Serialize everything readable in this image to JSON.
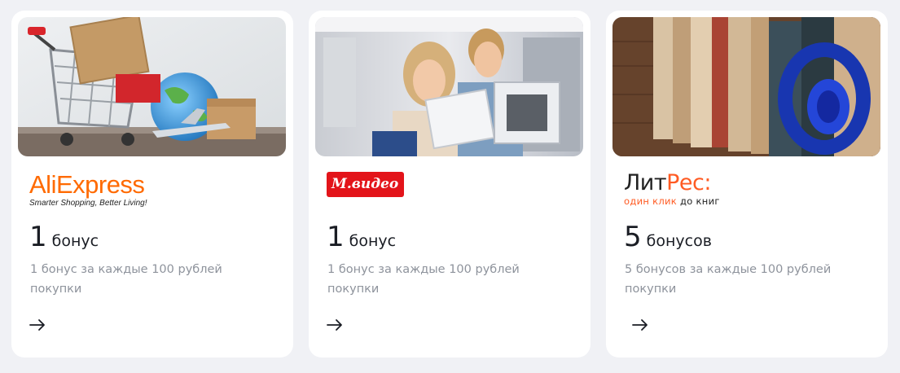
{
  "cards": [
    {
      "brand": "AliExpress",
      "brand_first": "Ali",
      "brand_rest": "Express",
      "tagline": "Smarter Shopping, Better Living!",
      "amount": "1",
      "unit": "бонус",
      "description": "1 бонус за каждые 100 рублей покупки",
      "photo_icon": "shopping-cart-with-boxes-photo",
      "accent_color": "#ff6a00"
    },
    {
      "brand": "М.видео",
      "amount": "1",
      "unit": "бонус",
      "description": "1 бонус за каждые 100 рублей покупки",
      "photo_icon": "couple-with-appliances-photo",
      "accent_color": "#e3141a"
    },
    {
      "brand": "ЛитРес",
      "brand_first": "Лит",
      "brand_rest": "Рес:",
      "tagline_accent": "один клик",
      "tagline_rest": " до книг",
      "amount": "5",
      "unit": "бонусов",
      "description": "5 бонусов за каждые 100 рублей покупки",
      "photo_icon": "books-and-headphones-photo",
      "accent_color": "#ff5b23"
    }
  ],
  "arrow_icon": "arrow-right-icon"
}
